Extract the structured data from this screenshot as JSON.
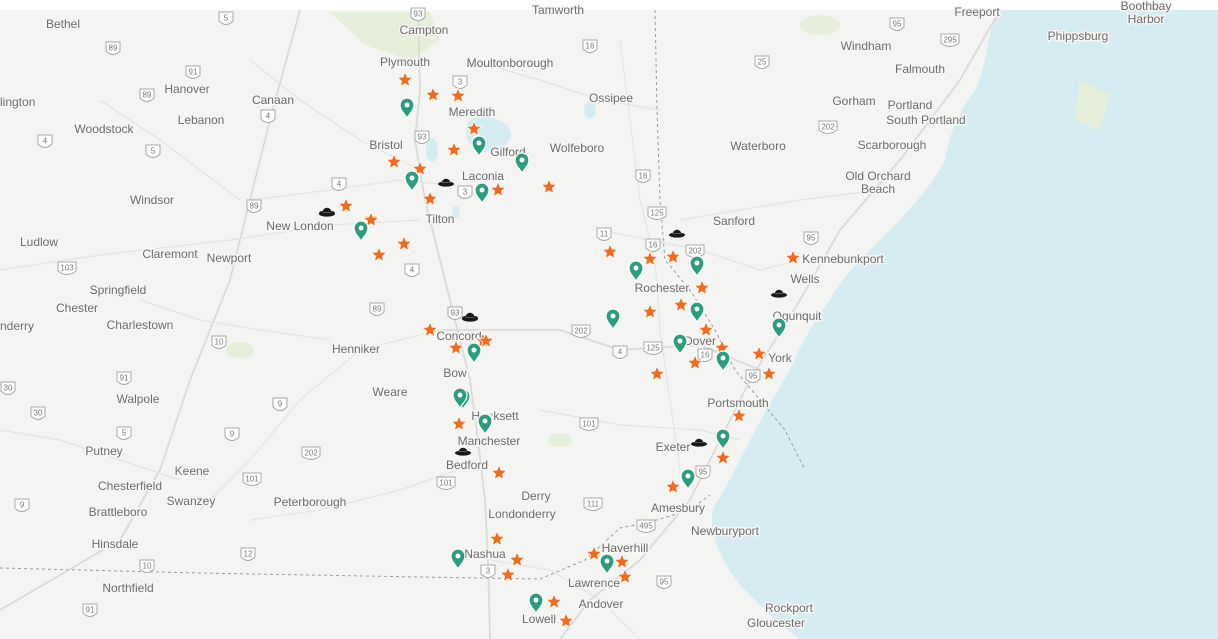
{
  "map": {
    "colors": {
      "background": "#f4f4f2",
      "ocean": "#d4ecf2",
      "star": "#f26b1d",
      "pin": "#2a9d7f",
      "hat": "#1a1a1a",
      "label": "#6b6b6b"
    },
    "place_labels": [
      {
        "name": "Bethel"
      },
      {
        "name": "Campton"
      },
      {
        "name": "Tamworth"
      },
      {
        "name": "Freeport"
      },
      {
        "name": "Boothbay Harbor"
      },
      {
        "name": "Windham"
      },
      {
        "name": "Phippsburg"
      },
      {
        "name": "Plymouth"
      },
      {
        "name": "Moultonborough"
      },
      {
        "name": "Falmouth"
      },
      {
        "name": "lington"
      },
      {
        "name": "Hanover"
      },
      {
        "name": "Canaan"
      },
      {
        "name": "Meredith"
      },
      {
        "name": "Ossipee"
      },
      {
        "name": "Gorham"
      },
      {
        "name": "Portland"
      },
      {
        "name": "South Portland"
      },
      {
        "name": "Woodstock"
      },
      {
        "name": "Lebanon"
      },
      {
        "name": "Bristol"
      },
      {
        "name": "Gilford"
      },
      {
        "name": "Wolfeboro"
      },
      {
        "name": "Waterboro"
      },
      {
        "name": "Scarborough"
      },
      {
        "name": "Laconia"
      },
      {
        "name": "Old Orchard Beach"
      },
      {
        "name": "Windsor"
      },
      {
        "name": "Tilton"
      },
      {
        "name": "Sanford"
      },
      {
        "name": "New London"
      },
      {
        "name": "Ludlow"
      },
      {
        "name": "Claremont"
      },
      {
        "name": "Newport"
      },
      {
        "name": "Kennebunkport"
      },
      {
        "name": "Rochester"
      },
      {
        "name": "Wells"
      },
      {
        "name": "Springfield"
      },
      {
        "name": "Chester"
      },
      {
        "name": "Charlestown"
      },
      {
        "name": "Ogunquit"
      },
      {
        "name": "nderry"
      },
      {
        "name": "Concord"
      },
      {
        "name": "Dover"
      },
      {
        "name": "Henniker"
      },
      {
        "name": "York"
      },
      {
        "name": "Bow"
      },
      {
        "name": "Weare"
      },
      {
        "name": "Walpole"
      },
      {
        "name": "Portsmouth"
      },
      {
        "name": "Hooksett"
      },
      {
        "name": "Manchester"
      },
      {
        "name": "Putney"
      },
      {
        "name": "Exeter"
      },
      {
        "name": "Keene"
      },
      {
        "name": "Bedford"
      },
      {
        "name": "Chesterfield"
      },
      {
        "name": "Swanzey"
      },
      {
        "name": "Derry"
      },
      {
        "name": "Peterborough"
      },
      {
        "name": "Brattleboro"
      },
      {
        "name": "Amesbury"
      },
      {
        "name": "Londonderry"
      },
      {
        "name": "Newburyport"
      },
      {
        "name": "Hinsdale"
      },
      {
        "name": "Haverhill"
      },
      {
        "name": "Nashua"
      },
      {
        "name": "Lawrence"
      },
      {
        "name": "Northfield"
      },
      {
        "name": "Andover"
      },
      {
        "name": "Rockport"
      },
      {
        "name": "Lowell"
      },
      {
        "name": "Gloucester"
      }
    ],
    "shields": [
      "5",
      "89",
      "93",
      "16",
      "295",
      "95",
      "3",
      "25",
      "91",
      "4",
      "89",
      "93",
      "202",
      "4",
      "5",
      "16",
      "4",
      "3",
      "89",
      "125",
      "11",
      "16",
      "202",
      "95",
      "103",
      "89",
      "4",
      "93",
      "202",
      "125",
      "16",
      "10",
      "4",
      "95",
      "91",
      "9",
      "5",
      "9",
      "101",
      "202",
      "101",
      "95",
      "101",
      "111",
      "495",
      "12",
      "10",
      "3",
      "95",
      "91",
      "30",
      "30",
      "9"
    ],
    "markers": {
      "stars": 47,
      "pins": 26,
      "hats": 9
    }
  }
}
